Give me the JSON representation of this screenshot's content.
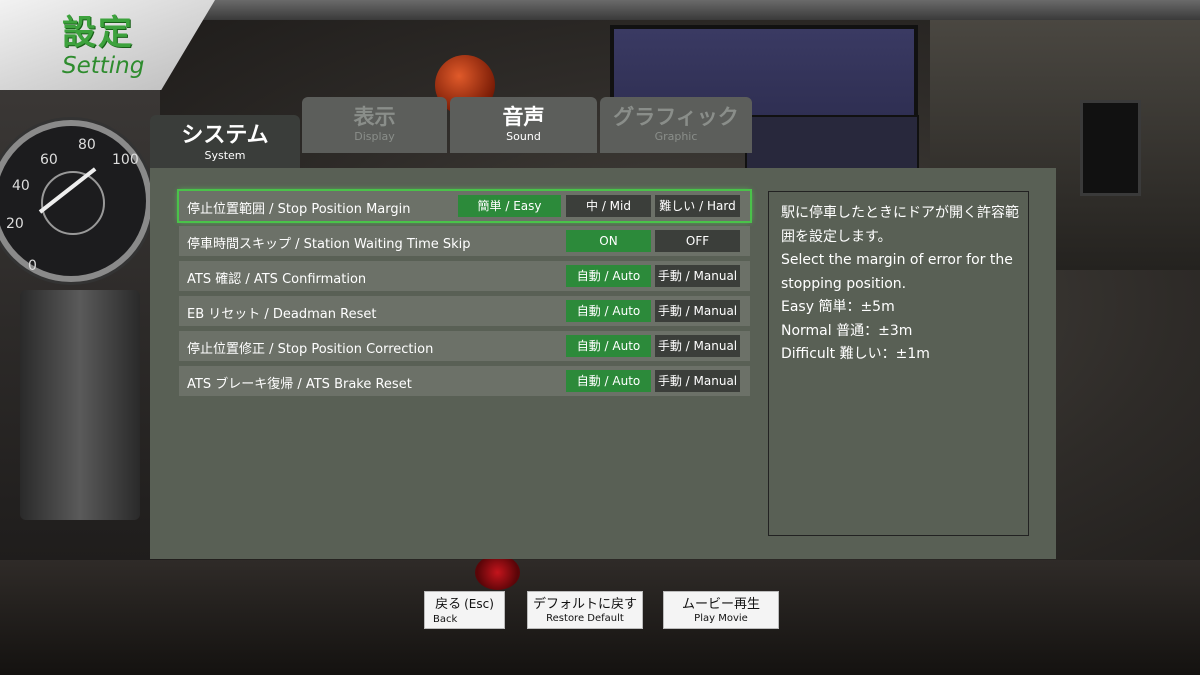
{
  "header": {
    "title_ja": "設定",
    "title_en": "Setting"
  },
  "tabs": [
    {
      "ja": "システム",
      "en": "System",
      "active": true
    },
    {
      "ja": "表示",
      "en": "Display",
      "active": false
    },
    {
      "ja": "音声",
      "en": "Sound",
      "active": false
    },
    {
      "ja": "グラフィック",
      "en": "Graphic",
      "active": false
    }
  ],
  "settings": [
    {
      "label": "停止位置範囲 / Stop Position Margin",
      "options": [
        "簡単 / Easy",
        "中 / Mid",
        "難しい / Hard"
      ],
      "selected": "簡単 / Easy"
    },
    {
      "label": "停車時間スキップ / Station Waiting Time Skip",
      "options": [
        "ON",
        "OFF"
      ],
      "selected": "ON"
    },
    {
      "label": "ATS 確認 / ATS Confirmation",
      "options": [
        "自動 / Auto",
        "手動 / Manual"
      ],
      "selected": "自動 / Auto"
    },
    {
      "label": "EB リセット / Deadman Reset",
      "options": [
        "自動 / Auto",
        "手動 / Manual"
      ],
      "selected": "自動 / Auto"
    },
    {
      "label": "停止位置修正 / Stop Position Correction",
      "options": [
        "自動 / Auto",
        "手動 / Manual"
      ],
      "selected": "自動 / Auto"
    },
    {
      "label": "ATS ブレーキ復帰 / ATS Brake Reset",
      "options": [
        "自動 / Auto",
        "手動 / Manual"
      ],
      "selected": "自動 / Auto"
    }
  ],
  "description": {
    "lines": [
      "駅に停車したときにドアが開く許容範",
      "囲を設定します。",
      "Select the margin of error for the",
      "stopping position.",
      "Easy 簡単：±5m",
      "Normal 普通：±3m",
      "Difficult 難しい：±1m"
    ]
  },
  "buttons": {
    "back": {
      "ja": "戻る",
      "key": "(Esc)",
      "en": "Back"
    },
    "restore": {
      "ja": "デフォルトに戻す",
      "en": "Restore Default"
    },
    "movie": {
      "ja": "ムービー再生",
      "en": "Play Movie"
    }
  },
  "background_labels": {
    "g40": "40",
    "g60": "60",
    "g80": "80",
    "g100": "100",
    "g20": "20",
    "g0": "0"
  },
  "colors": {
    "accent_green": "#2c8a3a",
    "title_green": "#3da23d",
    "selection_glow": "#4ac24a"
  }
}
